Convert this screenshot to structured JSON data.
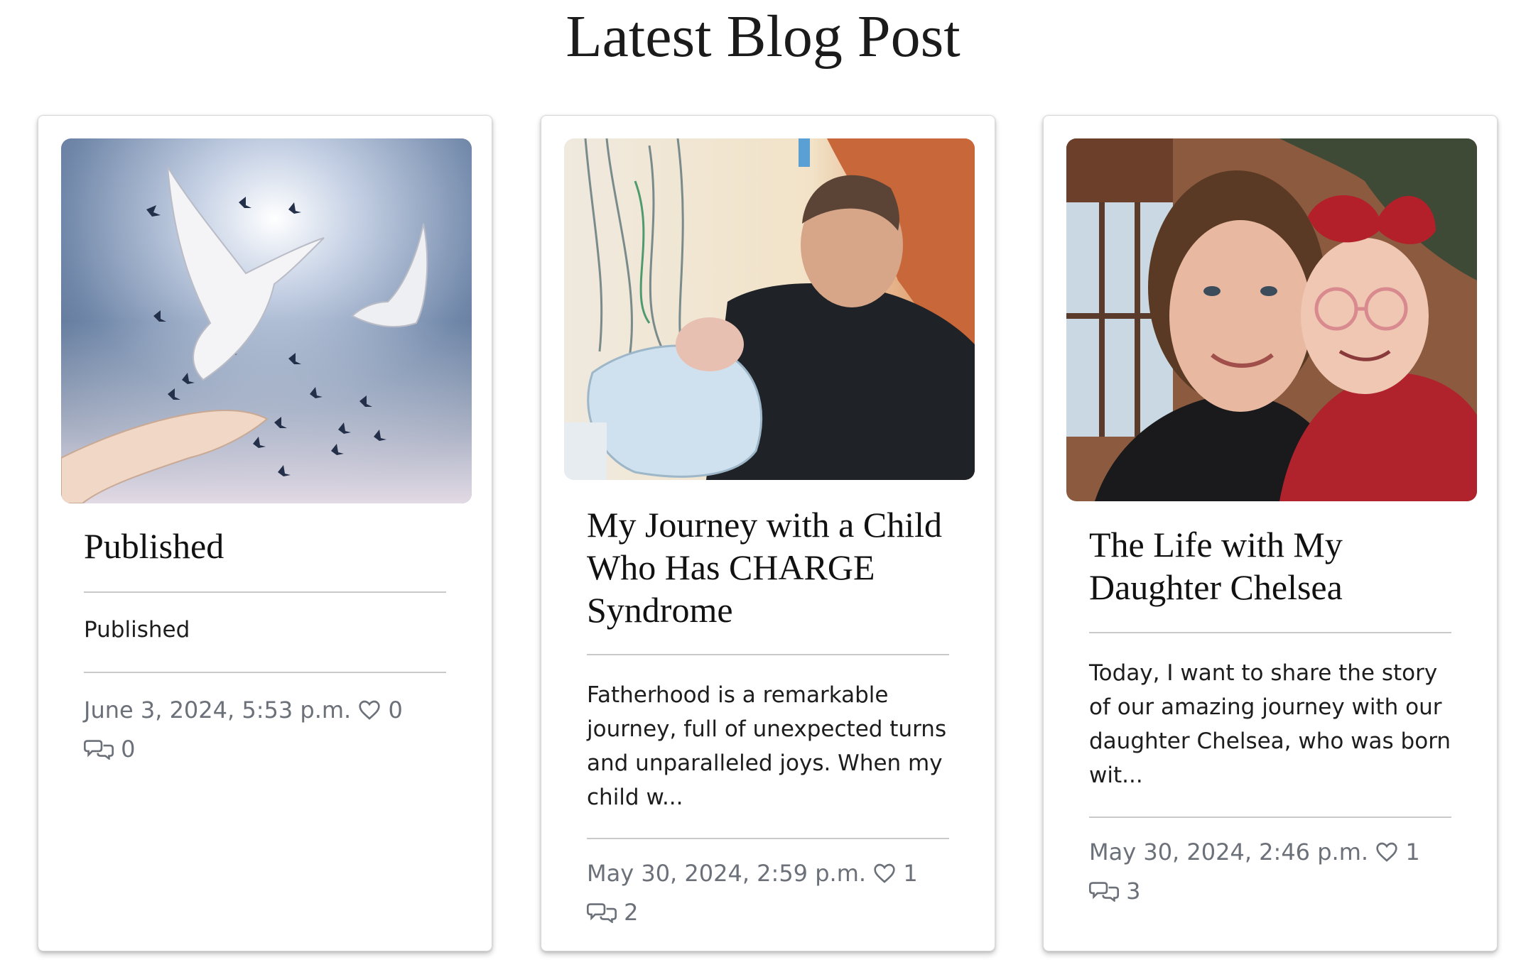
{
  "page": {
    "title": "Latest Blog Post"
  },
  "posts": [
    {
      "title": "Published",
      "excerpt": "Published",
      "date": "June 3, 2024, 5:53 p.m.",
      "likes": "0",
      "comments": "0",
      "image_desc_icon": "doves-photo"
    },
    {
      "title": "My Journey with a Child Who Has CHARGE Syndrome",
      "excerpt": "Fatherhood is a remarkable journey, full of unexpected turns and unparalleled joys. When my child w...",
      "date": "May 30, 2024, 2:59 p.m.",
      "likes": "1",
      "comments": "2",
      "image_desc_icon": "father-baby-photo"
    },
    {
      "title": "The Life with My Daughter Chelsea",
      "excerpt": "Today, I want to share the story of our amazing journey with our daughter Chelsea, who was born wit...",
      "date": "May 30, 2024, 2:46 p.m.",
      "likes": "1",
      "comments": "3",
      "image_desc_icon": "mother-daughter-photo"
    }
  ],
  "icons": {
    "like": "heart-icon",
    "comment": "comment-icon"
  },
  "colors": {
    "meta_text": "#6b7079",
    "divider": "#c9c9c9",
    "card_border": "#d8d8d8"
  }
}
